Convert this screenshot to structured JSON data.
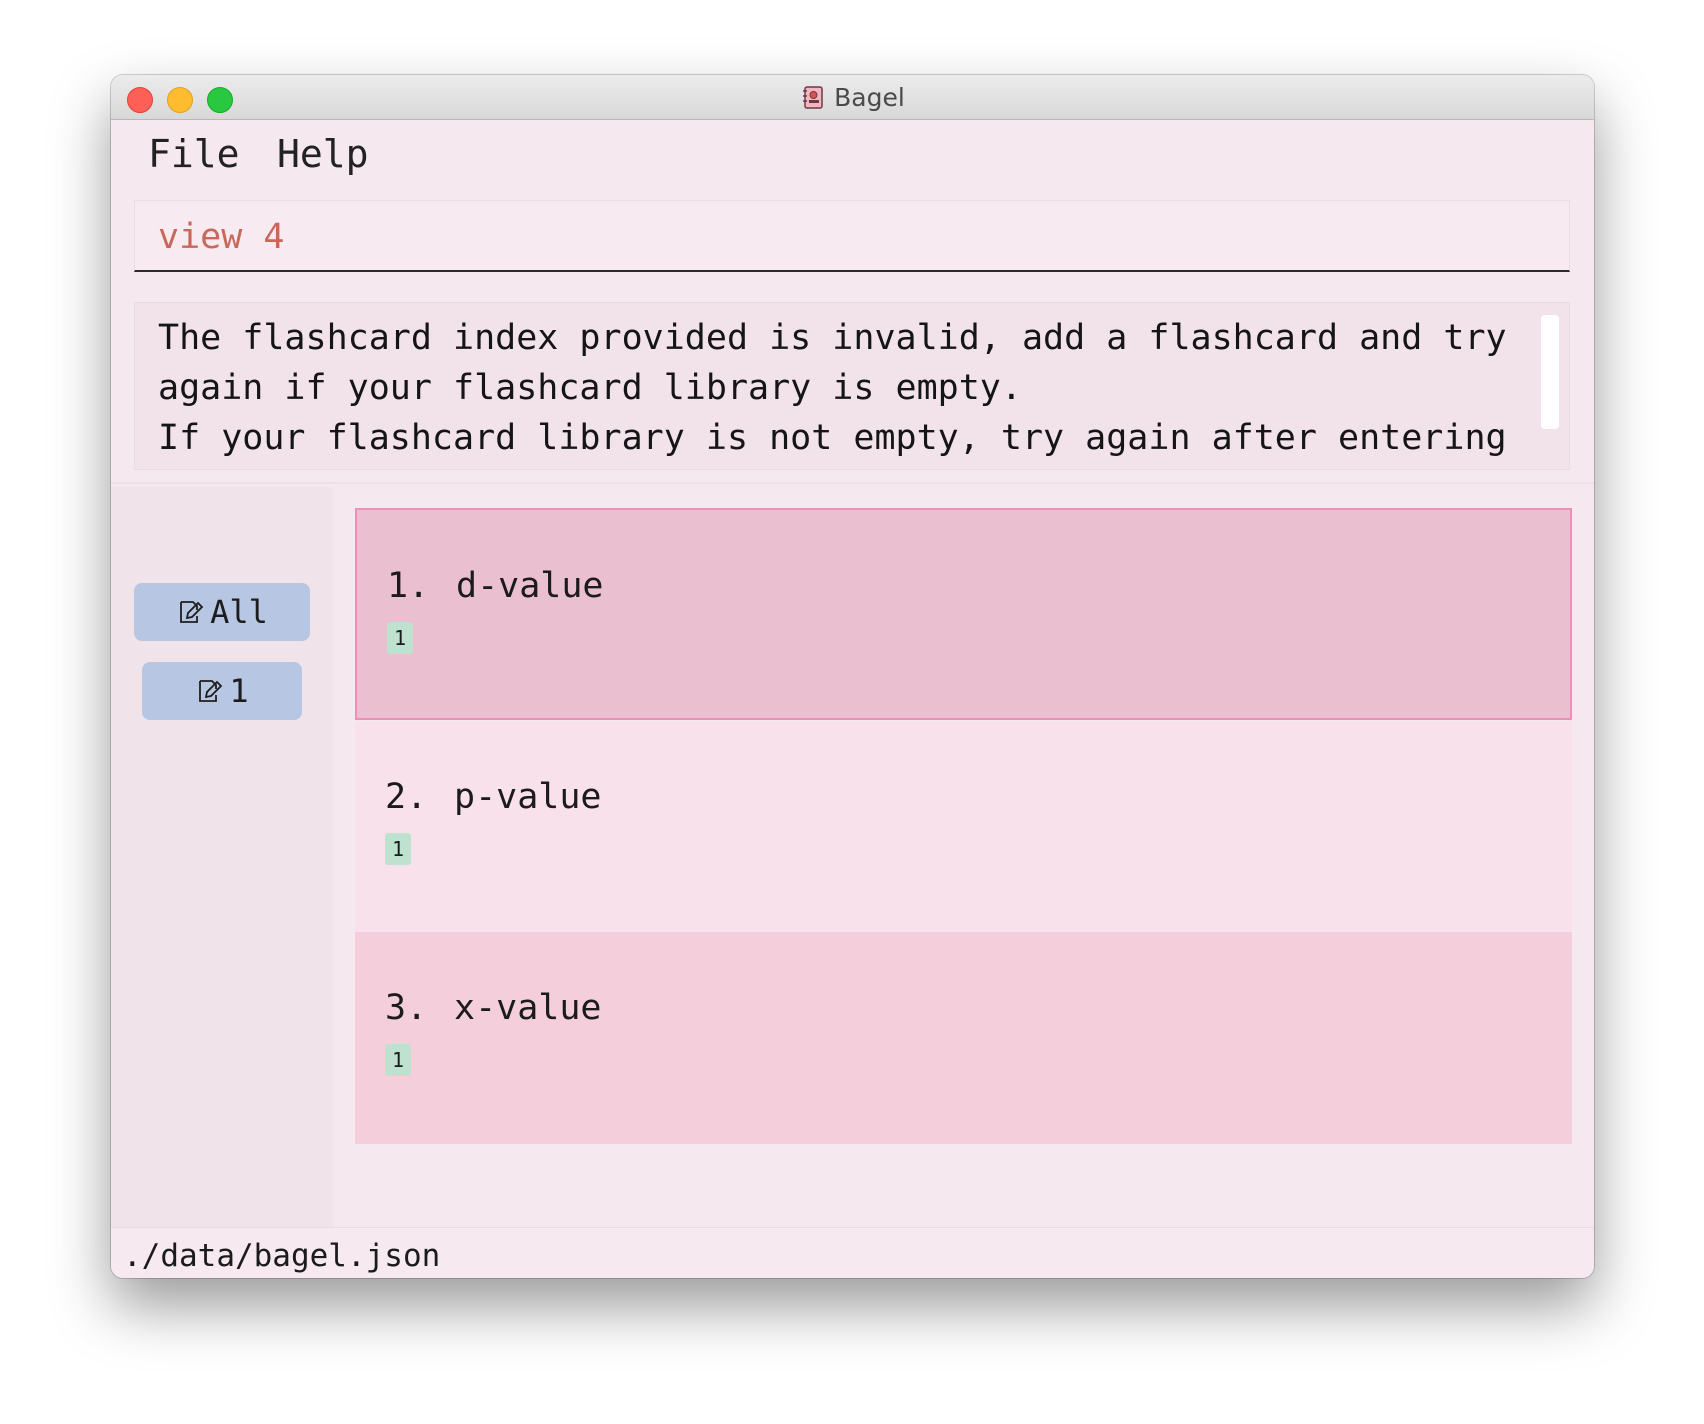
{
  "window": {
    "title": "Bagel",
    "app_icon": "notebook-icon"
  },
  "menu": {
    "file": "File",
    "help": "Help"
  },
  "command": {
    "value": "view 4"
  },
  "result": {
    "text": "The flashcard index provided is invalid, add a flashcard and try\nagain if your flashcard library is empty.\nIf your flashcard library is not empty, try again after entering"
  },
  "sidebar": {
    "buttons": [
      {
        "label": "All",
        "icon": "edit-icon"
      },
      {
        "label": "1",
        "icon": "edit-icon"
      }
    ]
  },
  "flashcards": [
    {
      "index": "1.",
      "title": "d-value",
      "tag": "1"
    },
    {
      "index": "2.",
      "title": "p-value",
      "tag": "1"
    },
    {
      "index": "3.",
      "title": "x-value",
      "tag": "1"
    }
  ],
  "status": {
    "path": "./data/bagel.json"
  },
  "colors": {
    "background": "#f5e8ef",
    "command_text": "#c8675a",
    "tag_button": "#b7c6e3",
    "selected_card": "#eabfcf",
    "selected_border": "#ef8fb8",
    "card_even": "#f8e1ea",
    "card_odd": "#f4ceda",
    "badge": "#bfe1cf"
  }
}
